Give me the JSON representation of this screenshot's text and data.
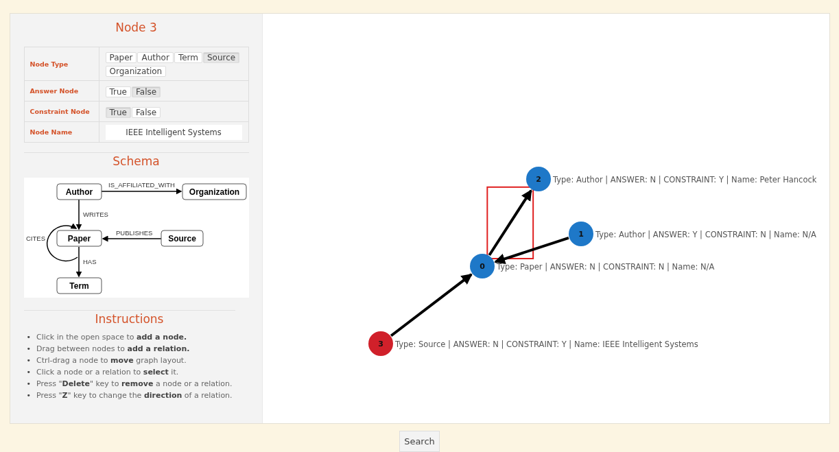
{
  "panel": {
    "title": "Node 3",
    "fields": [
      {
        "label": "Node Type",
        "kind": "choice",
        "options": [
          {
            "label": "Paper",
            "selected": false
          },
          {
            "label": "Author",
            "selected": false
          },
          {
            "label": "Term",
            "selected": false
          },
          {
            "label": "Source",
            "selected": true
          },
          {
            "label": "Organization",
            "selected": false
          }
        ]
      },
      {
        "label": "Answer Node",
        "kind": "choice",
        "options": [
          {
            "label": "True",
            "selected": false
          },
          {
            "label": "False",
            "selected": true
          }
        ]
      },
      {
        "label": "Constraint Node",
        "kind": "choice",
        "options": [
          {
            "label": "True",
            "selected": true
          },
          {
            "label": "False",
            "selected": false
          }
        ]
      },
      {
        "label": "Node Name",
        "kind": "text",
        "value": "IEEE Intelligent Systems"
      }
    ]
  },
  "schema": {
    "title": "Schema",
    "nodes": [
      {
        "label": "Author"
      },
      {
        "label": "Organization"
      },
      {
        "label": "Paper"
      },
      {
        "label": "Source"
      },
      {
        "label": "Term"
      }
    ],
    "edges": [
      {
        "label": "IS_AFFILIATED_WITH"
      },
      {
        "label": "WRITES"
      },
      {
        "label": "CITES"
      },
      {
        "label": "PUBLISHES"
      },
      {
        "label": "HAS"
      }
    ]
  },
  "instructions": {
    "title": "Instructions",
    "items": [
      {
        "bullet": "•",
        "text": "Click in the open space to **add a node.**"
      },
      {
        "bullet": "•",
        "text": "Drag between nodes to **add a relation.**"
      },
      {
        "bullet": "•",
        "text": "Ctrl-drag a node to **move** graph layout."
      },
      {
        "bullet": "•",
        "text": "Click a node or a relation to **select** it."
      },
      {
        "bullet": "•",
        "text": "Press \"**Delete**\" key to **remove** a node or a relation."
      },
      {
        "bullet": "•",
        "text": "Press \"**Z**\" key to change the **direction** of a relation."
      }
    ]
  },
  "graph": {
    "nodes": [
      {
        "id": "2",
        "label": "Type: Author | ANSWER: N | CONSTRAINT: Y | Name: Peter Hancock",
        "selected": false
      },
      {
        "id": "1",
        "label": "Type: Author | ANSWER: Y | CONSTRAINT: N | Name: N/A",
        "selected": false
      },
      {
        "id": "0",
        "label": "Type: Paper | ANSWER: N | CONSTRAINT: N | Name: N/A",
        "selected": false
      },
      {
        "id": "3",
        "label": "Type: Source | ANSWER: N | CONSTRAINT: Y | Name: IEEE Intelligent Systems",
        "selected": true
      }
    ],
    "edges": [
      {
        "selected": true
      },
      {
        "selected": false
      },
      {
        "selected": false
      }
    ]
  },
  "search_button": "Search"
}
